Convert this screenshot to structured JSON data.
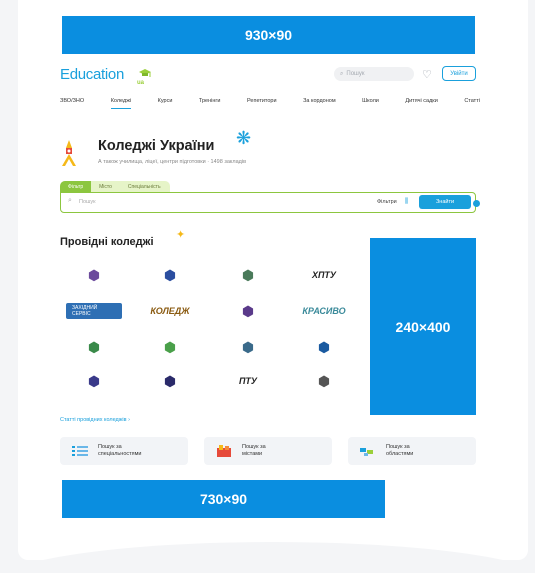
{
  "ads": {
    "top": "930×90",
    "side": "240×400",
    "bottom": "730×90"
  },
  "header": {
    "logo_text": "Education",
    "logo_suffix": "ua",
    "search_placeholder": "Пошук",
    "login_label": "Увійти"
  },
  "nav": {
    "items": [
      "ЗВО/ЗНО",
      "Коледжі",
      "Курси",
      "Тренінги",
      "Репетитори",
      "За кордоном",
      "Школи",
      "Дитячі садки",
      "Статті"
    ],
    "active": "Коледжі"
  },
  "page": {
    "title": "Коледжі України",
    "subtitle": "А також училища, ліцеї, центри підготовки · 1498 закладів"
  },
  "search": {
    "tabs": [
      "Фільтр",
      "Місто",
      "Спеціальність"
    ],
    "placeholder": "Пошук",
    "filters_label": "Фільтри",
    "find_label": "Знайти"
  },
  "leading": {
    "title": "Провідні коледжі",
    "logos": [
      {
        "label": "shield-logo",
        "color": "#6b4a9c"
      },
      {
        "label": "crest-logo",
        "color": "#2b4ea0"
      },
      {
        "label": "seal-logo",
        "color": "#4a7a5a"
      },
      {
        "label": "ХПТУ",
        "color": "#222222"
      },
      {
        "label": "ЗАХІДНИЙ СЕРВІС",
        "color": "#2e6fb4"
      },
      {
        "label": "КОЛЕДЖ",
        "color": "#8a5a10"
      },
      {
        "label": "figure-logo",
        "color": "#5a3a8a"
      },
      {
        "label": "КРАСИВО",
        "color": "#3a8a9a"
      },
      {
        "label": "round-logo",
        "color": "#3a8a4a"
      },
      {
        "label": "green-seal-logo",
        "color": "#4aa04a"
      },
      {
        "label": "oval-logo",
        "color": "#3a6a8a"
      },
      {
        "label": "tools-logo",
        "color": "#1a5aa0"
      },
      {
        "label": "circle-logo",
        "color": "#3a3a8a"
      },
      {
        "label": "tower-logo",
        "color": "#2a2a6a"
      },
      {
        "label": "ПТУ",
        "color": "#222222"
      },
      {
        "label": "figure-logo-2",
        "color": "#555555"
      }
    ],
    "all_link": "Статті провідних коледжів ›"
  },
  "search_cards": [
    {
      "line1": "Пошук за",
      "line2": "спеціальностями",
      "icon": "list-icon"
    },
    {
      "line1": "Пошук за",
      "line2": "містами",
      "icon": "map-icon"
    },
    {
      "line1": "Пошук за",
      "line2": "областями",
      "icon": "regions-icon"
    }
  ]
}
